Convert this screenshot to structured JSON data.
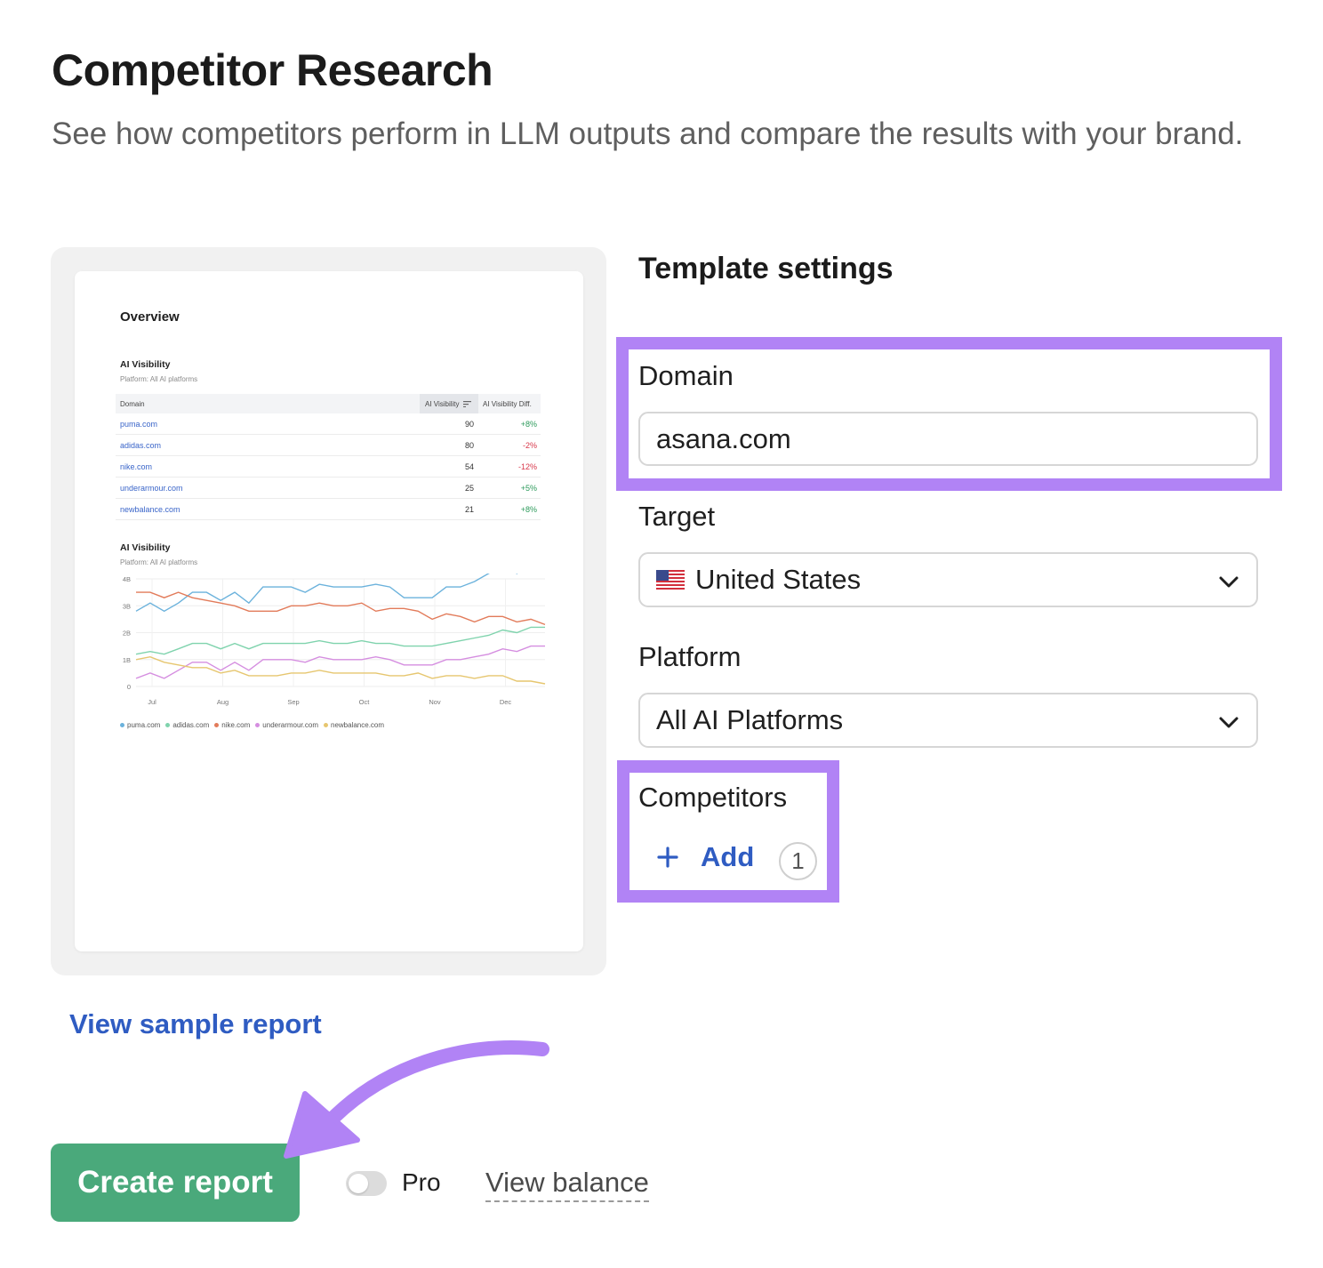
{
  "header": {
    "title": "Competitor Research",
    "subtitle": "See how competitors perform in LLM outputs and compare the results with your brand."
  },
  "preview": {
    "overview_label": "Overview",
    "table_title": "AI Visibility",
    "table_subtitle": "Platform: All AI platforms",
    "columns": [
      "Domain",
      "AI Visibility",
      "AI Visibility Diff."
    ],
    "rows": [
      {
        "domain": "puma.com",
        "visibility": "90",
        "diff": "+8%"
      },
      {
        "domain": "adidas.com",
        "visibility": "80",
        "diff": "-2%"
      },
      {
        "domain": "nike.com",
        "visibility": "54",
        "diff": "-12%"
      },
      {
        "domain": "underarmour.com",
        "visibility": "25",
        "diff": "+5%"
      },
      {
        "domain": "newbalance.com",
        "visibility": "21",
        "diff": "+8%"
      }
    ],
    "chart_title": "AI Visibility",
    "chart_subtitle": "Platform: All AI platforms",
    "chart_data": {
      "type": "line",
      "y_ticks": [
        "4B",
        "3B",
        "2B",
        "1B",
        "0"
      ],
      "x_ticks": [
        "Jul",
        "Aug",
        "Sep",
        "Oct",
        "Nov",
        "Dec"
      ],
      "ylim": [
        0,
        4
      ],
      "series": [
        {
          "name": "puma.com",
          "color": "#6bb2dc",
          "values": [
            2.8,
            3.1,
            2.8,
            3.1,
            3.5,
            3.5,
            3.2,
            3.5,
            3.1,
            3.7,
            3.7,
            3.7,
            3.5,
            3.8,
            3.7,
            3.7,
            3.7,
            3.8,
            3.7,
            3.3,
            3.3,
            3.3,
            3.7,
            3.7,
            3.9,
            4.2,
            4.5,
            4.2,
            4.5,
            4.5
          ]
        },
        {
          "name": "adidas.com",
          "color": "#7fd3ad",
          "values": [
            1.2,
            1.3,
            1.2,
            1.4,
            1.6,
            1.6,
            1.4,
            1.6,
            1.4,
            1.6,
            1.6,
            1.6,
            1.6,
            1.7,
            1.6,
            1.6,
            1.7,
            1.6,
            1.6,
            1.5,
            1.5,
            1.5,
            1.6,
            1.7,
            1.8,
            1.9,
            2.1,
            2.0,
            2.2,
            2.2
          ]
        },
        {
          "name": "nike.com",
          "color": "#e27b5a",
          "values": [
            3.5,
            3.5,
            3.3,
            3.5,
            3.3,
            3.2,
            3.1,
            3.0,
            2.8,
            2.8,
            2.8,
            3.0,
            3.0,
            3.1,
            3.0,
            3.0,
            3.1,
            2.8,
            2.9,
            2.9,
            2.8,
            2.5,
            2.7,
            2.6,
            2.4,
            2.6,
            2.6,
            2.4,
            2.5,
            2.3
          ]
        },
        {
          "name": "underarmour.com",
          "color": "#d58ee0",
          "values": [
            0.3,
            0.5,
            0.3,
            0.6,
            0.9,
            0.9,
            0.6,
            0.9,
            0.6,
            1.0,
            1.0,
            1.0,
            0.9,
            1.1,
            1.0,
            1.0,
            1.0,
            1.1,
            1.0,
            0.8,
            0.8,
            0.8,
            1.0,
            1.0,
            1.1,
            1.2,
            1.4,
            1.3,
            1.5,
            1.5
          ]
        },
        {
          "name": "newbalance.com",
          "color": "#e6c66f",
          "values": [
            1.0,
            1.1,
            0.9,
            0.8,
            0.7,
            0.7,
            0.5,
            0.6,
            0.4,
            0.4,
            0.4,
            0.5,
            0.5,
            0.6,
            0.5,
            0.5,
            0.5,
            0.5,
            0.4,
            0.4,
            0.5,
            0.3,
            0.4,
            0.4,
            0.3,
            0.4,
            0.4,
            0.2,
            0.2,
            0.1
          ]
        }
      ]
    }
  },
  "links": {
    "view_sample": "View sample report",
    "view_balance": "View balance"
  },
  "settings": {
    "title": "Template settings",
    "domain_label": "Domain",
    "domain_value": "asana.com",
    "target_label": "Target",
    "target_value": "United States",
    "platform_label": "Platform",
    "platform_value": "All AI Platforms",
    "competitors_label": "Competitors",
    "add_label": "Add",
    "competitor_count": "1"
  },
  "footer": {
    "create_label": "Create report",
    "pro_label": "Pro"
  },
  "colors": {
    "accent_purple": "#b183f5",
    "create_green": "#4aa97b",
    "link_blue": "#2f5cc2"
  }
}
